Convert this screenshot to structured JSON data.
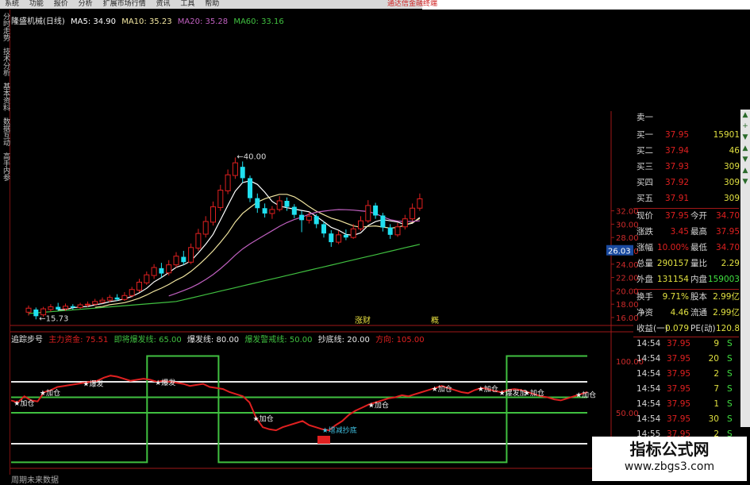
{
  "menu": {
    "items": [
      "系统",
      "功能",
      "报价",
      "分析",
      "扩展市场行情",
      "资讯",
      "工具",
      "帮助"
    ],
    "notice": "通达信金融终端"
  },
  "left_tabs": [
    "分时走势",
    "技术分析",
    "基本资料",
    "数据互动",
    "高手内参"
  ],
  "header": {
    "stock_title": "隆盛机械(日线)",
    "ma5": "MA5: 34.90",
    "ma10": "MA10: 35.23",
    "ma20": "MA20: 35.28",
    "ma60": "MA60: 33.16"
  },
  "colors": {
    "up": "#e02020",
    "down": "#20e0f0",
    "ma5": "#ffffff",
    "ma10": "#f2e6a0",
    "ma20": "#c060c0",
    "ma60": "#40c040",
    "axis": "#a01818"
  },
  "price_axis": {
    "labels": [
      "32.00",
      "30.00",
      "28.00",
      "26.00",
      "24.00",
      "22.00",
      "20.00",
      "18.00",
      "16.00"
    ],
    "current": "26.03",
    "low_marker": "15.73",
    "high_marker": "40.00"
  },
  "candle_annotations": [
    "涨财",
    "概"
  ],
  "candles": [
    {
      "o": 16.8,
      "c": 17.4,
      "h": 17.8,
      "l": 16.3
    },
    {
      "o": 17.2,
      "c": 16.2,
      "h": 17.5,
      "l": 15.73
    },
    {
      "o": 16.4,
      "c": 17.3,
      "h": 17.6,
      "l": 16.1
    },
    {
      "o": 17.2,
      "c": 17.6,
      "h": 18.0,
      "l": 16.9
    },
    {
      "o": 17.6,
      "c": 17.2,
      "h": 18.2,
      "l": 17.0
    },
    {
      "o": 17.3,
      "c": 17.7,
      "h": 18.1,
      "l": 17.0
    },
    {
      "o": 17.7,
      "c": 17.5,
      "h": 18.0,
      "l": 17.2
    },
    {
      "o": 17.5,
      "c": 17.9,
      "h": 18.2,
      "l": 17.3
    },
    {
      "o": 17.9,
      "c": 18.0,
      "h": 18.4,
      "l": 17.6
    },
    {
      "o": 18.0,
      "c": 18.4,
      "h": 18.8,
      "l": 17.8
    },
    {
      "o": 18.3,
      "c": 18.6,
      "h": 19.0,
      "l": 18.1
    },
    {
      "o": 18.6,
      "c": 19.0,
      "h": 19.4,
      "l": 18.3
    },
    {
      "o": 19.0,
      "c": 18.7,
      "h": 19.5,
      "l": 18.5
    },
    {
      "o": 18.7,
      "c": 19.3,
      "h": 19.8,
      "l": 18.5
    },
    {
      "o": 19.3,
      "c": 20.2,
      "h": 20.6,
      "l": 19.0
    },
    {
      "o": 20.1,
      "c": 21.3,
      "h": 21.8,
      "l": 19.8
    },
    {
      "o": 21.2,
      "c": 22.4,
      "h": 22.9,
      "l": 20.9
    },
    {
      "o": 22.3,
      "c": 23.5,
      "h": 24.0,
      "l": 21.8
    },
    {
      "o": 23.4,
      "c": 22.6,
      "h": 24.2,
      "l": 22.0
    },
    {
      "o": 22.7,
      "c": 23.9,
      "h": 24.6,
      "l": 22.3
    },
    {
      "o": 23.9,
      "c": 25.2,
      "h": 25.8,
      "l": 23.5
    },
    {
      "o": 25.1,
      "c": 24.3,
      "h": 26.0,
      "l": 23.9
    },
    {
      "o": 24.3,
      "c": 26.5,
      "h": 27.1,
      "l": 24.0
    },
    {
      "o": 26.4,
      "c": 28.6,
      "h": 29.3,
      "l": 26.0
    },
    {
      "o": 28.5,
      "c": 30.4,
      "h": 31.2,
      "l": 28.0
    },
    {
      "o": 30.3,
      "c": 32.6,
      "h": 33.4,
      "l": 29.8
    },
    {
      "o": 32.5,
      "c": 35.1,
      "h": 35.9,
      "l": 32.0
    },
    {
      "o": 35.0,
      "c": 37.4,
      "h": 38.2,
      "l": 34.5
    },
    {
      "o": 37.3,
      "c": 39.2,
      "h": 40.0,
      "l": 36.8
    },
    {
      "o": 38.6,
      "c": 36.9,
      "h": 39.4,
      "l": 36.2
    },
    {
      "o": 36.9,
      "c": 33.9,
      "h": 37.3,
      "l": 33.3
    },
    {
      "o": 33.9,
      "c": 32.4,
      "h": 34.6,
      "l": 31.7
    },
    {
      "o": 32.4,
      "c": 31.6,
      "h": 33.1,
      "l": 31.0
    },
    {
      "o": 31.6,
      "c": 32.2,
      "h": 32.7,
      "l": 30.8
    },
    {
      "o": 32.2,
      "c": 33.5,
      "h": 34.2,
      "l": 31.9
    },
    {
      "o": 33.5,
      "c": 32.6,
      "h": 34.0,
      "l": 32.0
    },
    {
      "o": 32.6,
      "c": 31.4,
      "h": 33.0,
      "l": 30.9
    },
    {
      "o": 31.4,
      "c": 30.6,
      "h": 32.0,
      "l": 28.8
    },
    {
      "o": 30.6,
      "c": 31.2,
      "h": 31.8,
      "l": 30.1
    },
    {
      "o": 31.2,
      "c": 30.0,
      "h": 31.5,
      "l": 29.4
    },
    {
      "o": 30.0,
      "c": 28.6,
      "h": 30.4,
      "l": 28.0
    },
    {
      "o": 28.6,
      "c": 27.3,
      "h": 29.1,
      "l": 26.6
    },
    {
      "o": 27.3,
      "c": 28.4,
      "h": 29.0,
      "l": 27.0
    },
    {
      "o": 28.4,
      "c": 28.0,
      "h": 29.2,
      "l": 27.6
    },
    {
      "o": 28.0,
      "c": 29.3,
      "h": 30.0,
      "l": 27.8
    },
    {
      "o": 29.3,
      "c": 30.5,
      "h": 31.2,
      "l": 29.0
    },
    {
      "o": 30.5,
      "c": 32.8,
      "h": 33.6,
      "l": 30.2
    },
    {
      "o": 32.8,
      "c": 31.3,
      "h": 33.2,
      "l": 30.8
    },
    {
      "o": 31.3,
      "c": 29.5,
      "h": 31.7,
      "l": 28.9
    },
    {
      "o": 29.5,
      "c": 28.4,
      "h": 30.0,
      "l": 27.8
    },
    {
      "o": 28.4,
      "c": 29.6,
      "h": 30.2,
      "l": 28.1
    },
    {
      "o": 29.6,
      "c": 30.8,
      "h": 31.4,
      "l": 29.2
    },
    {
      "o": 30.8,
      "c": 32.4,
      "h": 33.1,
      "l": 30.5
    },
    {
      "o": 32.4,
      "c": 33.8,
      "h": 34.6,
      "l": 32.0
    }
  ],
  "indicator": {
    "name": "追踪步号",
    "params": [
      {
        "label": "主力资金: 75.51",
        "color": "#e02020"
      },
      {
        "label": "即将爆发线: 65.00",
        "color": "#40c040"
      },
      {
        "label": "爆发线: 80.00",
        "color": "#e8e8e8"
      },
      {
        "label": "爆发警戒线: 50.00",
        "color": "#40c040"
      },
      {
        "label": "抄底线: 20.00",
        "color": "#e8e8e8"
      },
      {
        "label": "方向: 105.00",
        "color": "#e02020"
      }
    ],
    "axis_labels": [
      "100.00",
      "50.00"
    ],
    "main_fund": [
      62,
      60,
      66,
      62,
      61,
      70,
      72,
      75,
      76,
      77,
      78,
      79,
      80,
      81,
      84,
      86,
      85,
      83,
      81,
      82,
      83,
      82,
      80,
      81,
      80,
      79,
      78,
      76,
      77,
      78,
      75,
      74,
      73,
      70,
      68,
      66,
      60,
      45,
      36,
      34,
      33,
      36,
      38,
      40,
      42,
      38,
      36,
      34,
      33,
      38,
      42,
      48,
      52,
      55,
      58,
      60,
      62,
      64,
      65,
      67,
      66,
      68,
      70,
      72,
      74,
      76,
      74,
      72,
      70,
      69,
      72,
      74,
      73,
      71,
      70,
      72,
      73,
      72,
      70,
      68,
      66,
      65,
      63,
      62,
      64,
      66,
      68,
      70
    ],
    "direction_steps": [
      {
        "from": 0,
        "to": 0.236,
        "v": 2
      },
      {
        "from": 0.236,
        "to": 0.36,
        "v": 105
      },
      {
        "from": 0.36,
        "to": 0.86,
        "v": 2
      },
      {
        "from": 0.86,
        "to": 1.0,
        "v": 105
      }
    ],
    "markers": [
      "加仓",
      "加仓",
      "爆发",
      "爆发",
      "加仓",
      "增减抄底",
      "加仓",
      "加仓",
      "加仓",
      "爆发加",
      "加仓",
      "加仓"
    ],
    "bottom_label": "周期未来数据"
  },
  "quotes": {
    "sell": {
      "label": "卖一",
      "price": "",
      "vol": ""
    },
    "buy": [
      {
        "label": "买一",
        "price": "37.95",
        "vol": "15901"
      },
      {
        "label": "买二",
        "price": "37.94",
        "vol": "46"
      },
      {
        "label": "买三",
        "price": "37.93",
        "vol": "309"
      },
      {
        "label": "买四",
        "price": "37.92",
        "vol": "309"
      },
      {
        "label": "买五",
        "price": "37.91",
        "vol": "309"
      }
    ],
    "stats": [
      {
        "a": "现价",
        "av": "37.95",
        "b": "今开",
        "bv": "34.70"
      },
      {
        "a": "涨跌",
        "av": "3.45",
        "b": "最高",
        "bv": "37.95"
      },
      {
        "a": "涨幅",
        "av": "10.00%",
        "b": "最低",
        "bv": "34.70"
      },
      {
        "a": "总量",
        "av": "290157",
        "b": "量比",
        "bv": "2.29"
      },
      {
        "a": "外盘",
        "av": "131154",
        "b": "内盘",
        "bv": "159003"
      }
    ],
    "stats2": [
      {
        "a": "换手",
        "av": "9.71%",
        "b": "股本",
        "bv": "2.99亿"
      },
      {
        "a": "净资",
        "av": "4.46",
        "b": "流通",
        "bv": "2.99亿"
      },
      {
        "a": "收益(一)",
        "av": "0.079",
        "b": "PE(动)",
        "bv": "120.8"
      }
    ],
    "ticks": [
      {
        "t": "14:54",
        "p": "37.95",
        "v": "9",
        "s": "S"
      },
      {
        "t": "14:54",
        "p": "37.95",
        "v": "20",
        "s": "S"
      },
      {
        "t": "14:54",
        "p": "37.95",
        "v": "2",
        "s": "S"
      },
      {
        "t": "14:54",
        "p": "37.95",
        "v": "7",
        "s": "S"
      },
      {
        "t": "14:54",
        "p": "37.95",
        "v": "1",
        "s": "S"
      },
      {
        "t": "14:54",
        "p": "37.95",
        "v": "30",
        "s": "S"
      },
      {
        "t": "14:55",
        "p": "37.95",
        "v": "2",
        "s": "S"
      },
      {
        "t": "14:55",
        "p": "37.95",
        "v": "1",
        "s": "S"
      }
    ]
  },
  "watermark": {
    "title": "指标公式网",
    "url": "www.zbgs3.com"
  }
}
